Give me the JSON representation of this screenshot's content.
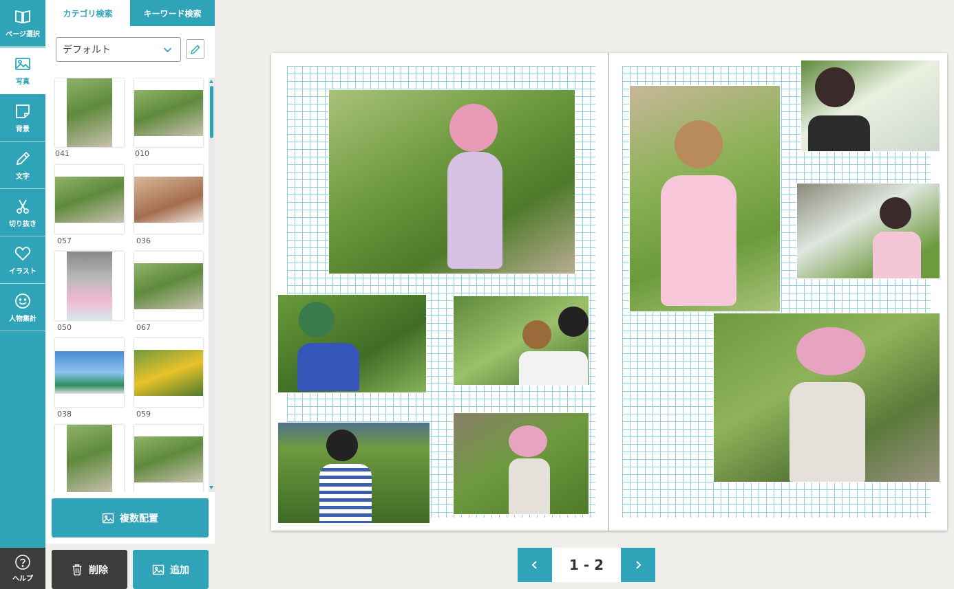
{
  "rail": {
    "items": [
      {
        "label": "ページ選択",
        "icon": "book-icon"
      },
      {
        "label": "写真",
        "icon": "photo-icon"
      },
      {
        "label": "背景",
        "icon": "background-icon"
      },
      {
        "label": "文字",
        "icon": "pencil-icon"
      },
      {
        "label": "切り抜き",
        "icon": "scissors-icon"
      },
      {
        "label": "イラスト",
        "icon": "heart-icon"
      },
      {
        "label": "人物集計",
        "icon": "smiley-icon"
      }
    ],
    "help_label": "ヘルプ",
    "active_index": 1
  },
  "panel": {
    "tabs": [
      {
        "label": "カテゴリ検索"
      },
      {
        "label": "キーワード検索"
      }
    ],
    "active_tab": 1,
    "folder_select_value": "デフォルト",
    "thumbnails": [
      {
        "label": "041"
      },
      {
        "label": "010"
      },
      {
        "label": "057"
      },
      {
        "label": "036"
      },
      {
        "label": "050"
      },
      {
        "label": "067"
      },
      {
        "label": "038"
      },
      {
        "label": "059"
      },
      {
        "label": ""
      },
      {
        "label": ""
      }
    ],
    "multi_place_label": "複数配置",
    "delete_label": "削除",
    "add_label": "追加"
  },
  "pager": {
    "label": "1 - 2"
  },
  "colors": {
    "accent": "#2fa3b8",
    "dark": "#3d3d3d",
    "grid": "#8fd0dd"
  }
}
